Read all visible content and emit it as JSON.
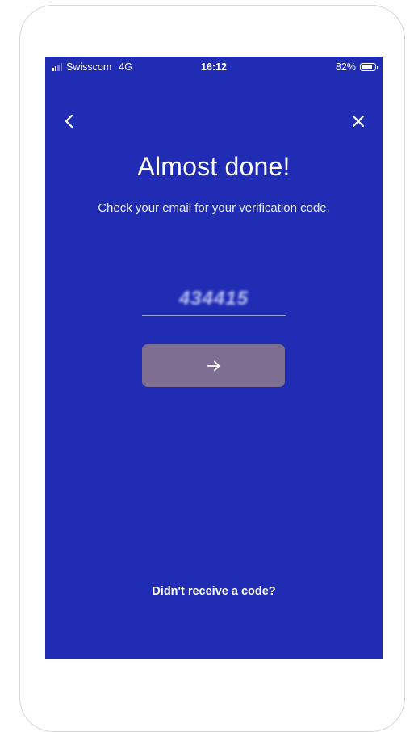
{
  "status_bar": {
    "carrier": "Swisscom",
    "network": "4G",
    "time": "16:12",
    "battery_percent": "82%",
    "battery_level": 0.82
  },
  "nav": {
    "back_icon": "chevron-left-icon",
    "close_icon": "close-icon"
  },
  "main": {
    "title": "Almost done!",
    "subtitle": "Check your email for your verification code.",
    "code_value": "434415",
    "submit_icon": "arrow-right-icon",
    "resend_label": "Didn't receive a code?"
  },
  "colors": {
    "background": "#1f2cb3",
    "button": "#7e6e91",
    "text": "#ffffff"
  }
}
